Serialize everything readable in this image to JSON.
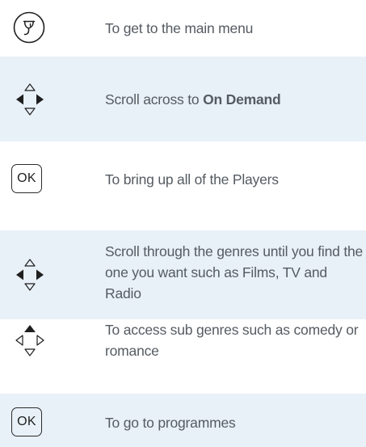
{
  "rows": [
    {
      "icon": "sky-home-button-icon",
      "text": "To get to the main menu"
    },
    {
      "icon": "dpad-left-right-icon",
      "text_before": "Scroll across to ",
      "text_bold": "On Demand"
    },
    {
      "icon": "ok-button-icon",
      "icon_label": "OK",
      "text": "To bring up all of the Players"
    },
    {
      "icon": "dpad-left-right-icon",
      "text": "Scroll through the genres until you find the one you want such as Films, TV and Radio"
    },
    {
      "icon": "dpad-up-icon",
      "text": "To access sub genres such as comedy or romance"
    },
    {
      "icon": "ok-button-icon",
      "icon_label": "OK",
      "text": "To go to programmes"
    }
  ],
  "colors": {
    "band_blue": "#e8f1f8",
    "text": "#555b62",
    "icon": "#1f1f1f"
  }
}
